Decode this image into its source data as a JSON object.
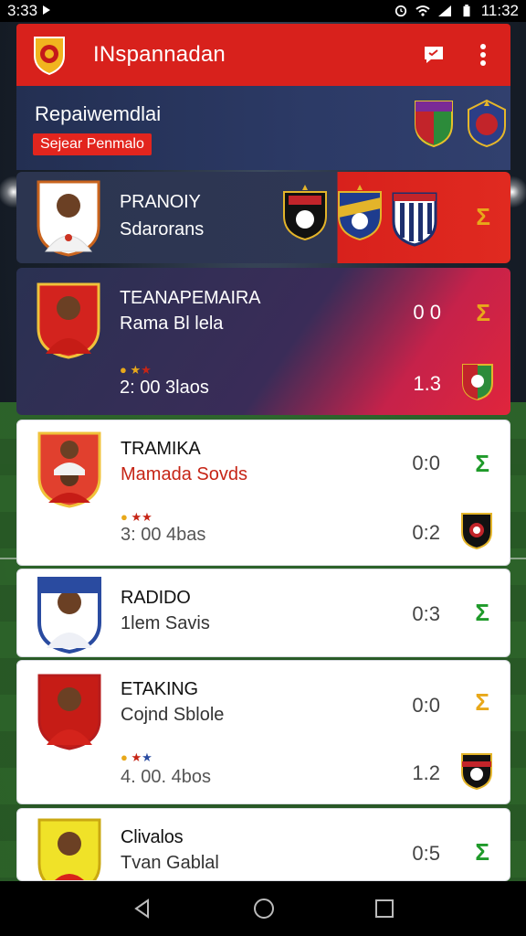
{
  "status_bar": {
    "time_left": "3:33 ",
    "time_right": "11:32"
  },
  "app_bar": {
    "title": "INspannadan"
  },
  "header": {
    "title": "Repaiwemdlai",
    "chip": "Sejear Penmalo"
  },
  "cards": [
    {
      "name": "PRANOIY",
      "subtitle": "Sdarorans"
    },
    {
      "name": "TEANAPEMAIRA",
      "subtitle": "Rama Bl lela",
      "score_top": "0 0",
      "time": "2: 00 3laos",
      "score_bottom": "1.3"
    },
    {
      "name": "TRAMIKA",
      "subtitle": "Mamada Sovds",
      "score_top": "0:0",
      "time": "3: 00 4bas",
      "score_bottom": "0:2"
    },
    {
      "name": "RADIDO",
      "subtitle": "1lem Savis",
      "score_top": "0:3"
    },
    {
      "name": "ETAKING",
      "subtitle": "Cojnd Sblole",
      "score_top": "0:0",
      "time": "4. 00. 4bos",
      "score_bottom": "1.2"
    },
    {
      "name": "Clivalos",
      "subtitle": "Tvan Gablal",
      "score_top": "0:5"
    }
  ],
  "colors": {
    "brand_red": "#d8211c",
    "navy": "#232f52",
    "sigma_green": "#1f9a2a",
    "sigma_orange": "#e8a81a"
  }
}
